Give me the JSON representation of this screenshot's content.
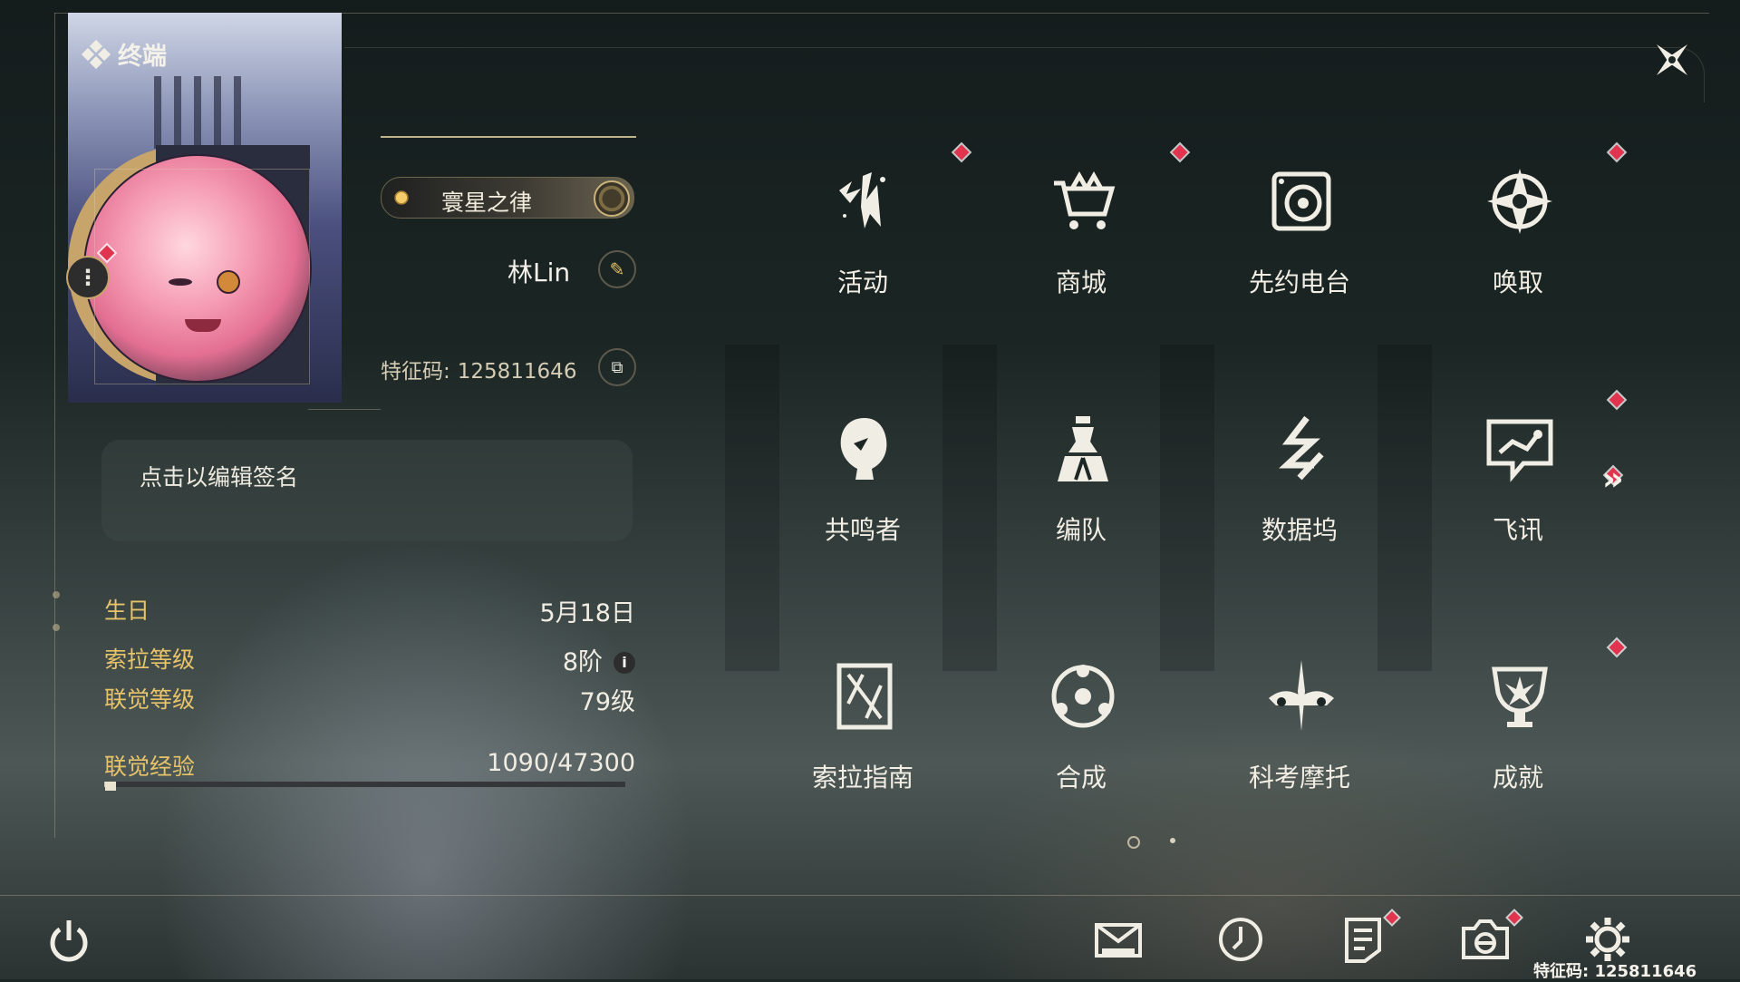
{
  "window": {
    "title": "终端"
  },
  "profile": {
    "rank_label": "寰星之律",
    "player_name": "林Lin",
    "uid_label": "特征码:",
    "uid_value": "125811646",
    "signature_placeholder": "点击以编辑签名"
  },
  "stats": [
    {
      "label": "生日",
      "value": "5月18日"
    },
    {
      "label": "索拉等级",
      "value": "8阶"
    },
    {
      "label": "联觉等级",
      "value": "79级"
    },
    {
      "label": "联觉经验",
      "value": "1090/47300"
    }
  ],
  "exp_progress": {
    "current": 1090,
    "max": 47300
  },
  "grid": [
    {
      "label": "活动",
      "icon": "activity-icon",
      "badge": true
    },
    {
      "label": "商城",
      "icon": "shop-cart-icon",
      "badge": true
    },
    {
      "label": "先约电台",
      "icon": "radio-icon",
      "badge": false
    },
    {
      "label": "唤取",
      "icon": "convene-icon",
      "badge": true
    },
    {
      "label": "共鸣者",
      "icon": "resonator-head-icon",
      "badge": false
    },
    {
      "label": "编队",
      "icon": "chess-team-icon",
      "badge": false
    },
    {
      "label": "数据坞",
      "icon": "data-bank-icon",
      "badge": false
    },
    {
      "label": "飞讯",
      "icon": "chat-message-icon",
      "badge": true
    },
    {
      "label": "索拉指南",
      "icon": "guidebook-icon",
      "badge": false
    },
    {
      "label": "合成",
      "icon": "synthesis-icon",
      "badge": false
    },
    {
      "label": "科考摩托",
      "icon": "motorbike-icon",
      "badge": false
    },
    {
      "label": "成就",
      "icon": "trophy-icon",
      "badge": true
    }
  ],
  "pager": {
    "current": 1,
    "total": 2
  },
  "footer": {
    "uid_text": "特征码: 125811646"
  },
  "colors": {
    "accent_gold": "#e7c36a",
    "badge_red": "#e0344f",
    "text_light": "#f2eee4"
  }
}
